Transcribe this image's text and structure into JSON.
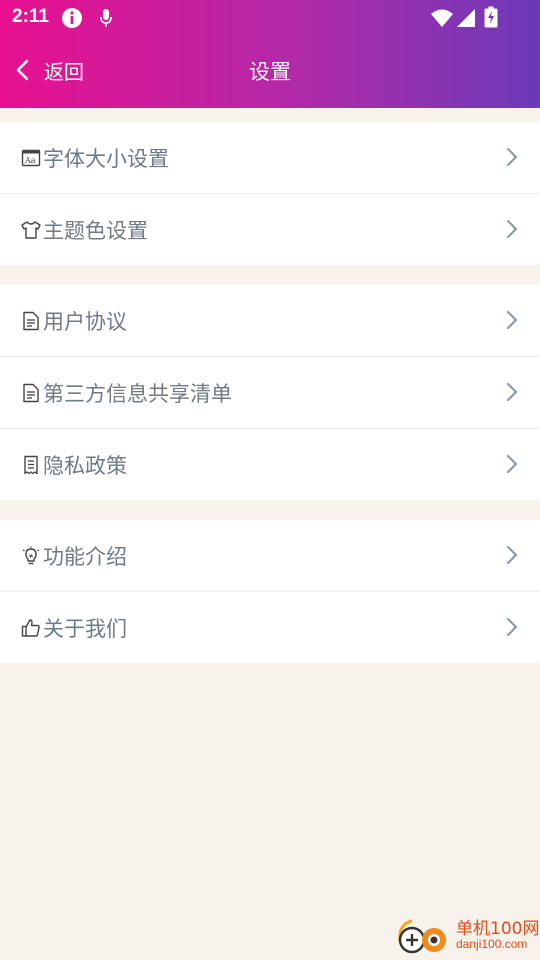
{
  "status_bar": {
    "time": "2:11"
  },
  "header": {
    "back_label": "返回",
    "title": "设置"
  },
  "groups": [
    {
      "items": [
        {
          "label": "字体大小设置",
          "icon": "font-size-icon"
        },
        {
          "label": "主题色设置",
          "icon": "tshirt-icon"
        }
      ]
    },
    {
      "items": [
        {
          "label": "用户协议",
          "icon": "document-icon"
        },
        {
          "label": "第三方信息共享清单",
          "icon": "document-icon"
        },
        {
          "label": "隐私政策",
          "icon": "receipt-icon"
        }
      ]
    },
    {
      "items": [
        {
          "label": "功能介绍",
          "icon": "lightbulb-icon"
        },
        {
          "label": "关于我们",
          "icon": "thumbs-up-icon"
        }
      ]
    }
  ],
  "watermark": {
    "name": "单机100网",
    "domain": "danji100.com"
  },
  "colors": {
    "header_gradient_start": "#e8108f",
    "header_gradient_end": "#6b3ab8",
    "background": "#f7f3ec",
    "label_text": "#6f7a86"
  }
}
